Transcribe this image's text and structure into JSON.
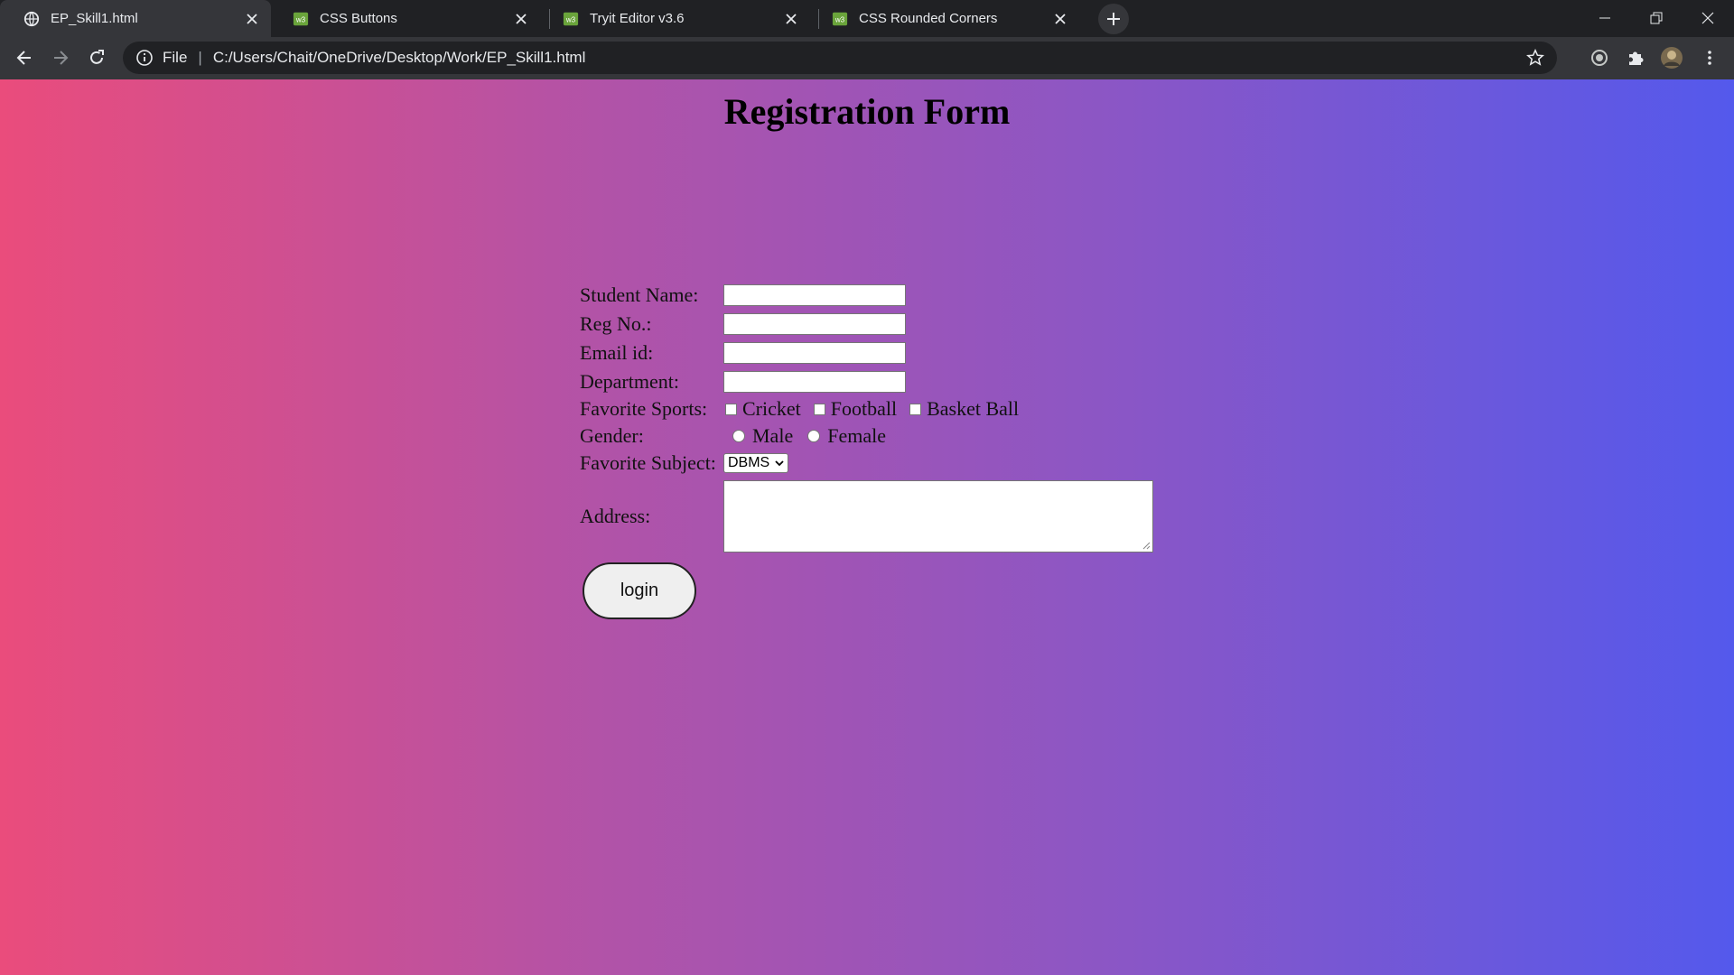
{
  "browser": {
    "tabs": [
      {
        "title": "EP_Skill1.html",
        "active": true,
        "favicon": "globe-icon"
      },
      {
        "title": "CSS Buttons",
        "active": false,
        "favicon": "w3schools-icon"
      },
      {
        "title": "Tryit Editor v3.6",
        "active": false,
        "favicon": "w3schools-icon"
      },
      {
        "title": "CSS Rounded Corners",
        "active": false,
        "favicon": "w3schools-icon"
      }
    ],
    "address": {
      "scheme_label": "File",
      "url": "C:/Users/Chait/OneDrive/Desktop/Work/EP_Skill1.html"
    }
  },
  "page": {
    "title": "Registration Form",
    "form": {
      "student_name_label": "Student Name:",
      "reg_no_label": "Reg No.:",
      "email_label": "Email id:",
      "department_label": "Department:",
      "sports_label": "Favorite Sports:",
      "sports_options": [
        "Cricket",
        "Football",
        "Basket Ball"
      ],
      "gender_label": "Gender:",
      "gender_options": [
        "Male",
        "Female"
      ],
      "subject_label": "Favorite Subject:",
      "subject_selected": "DBMS",
      "address_label": "Address:",
      "submit_label": "login"
    }
  },
  "colors": {
    "gradient_start": "#ea4c7c",
    "gradient_end": "#5459ec",
    "chrome_dark": "#202124",
    "chrome_toolbar": "#35363a"
  }
}
